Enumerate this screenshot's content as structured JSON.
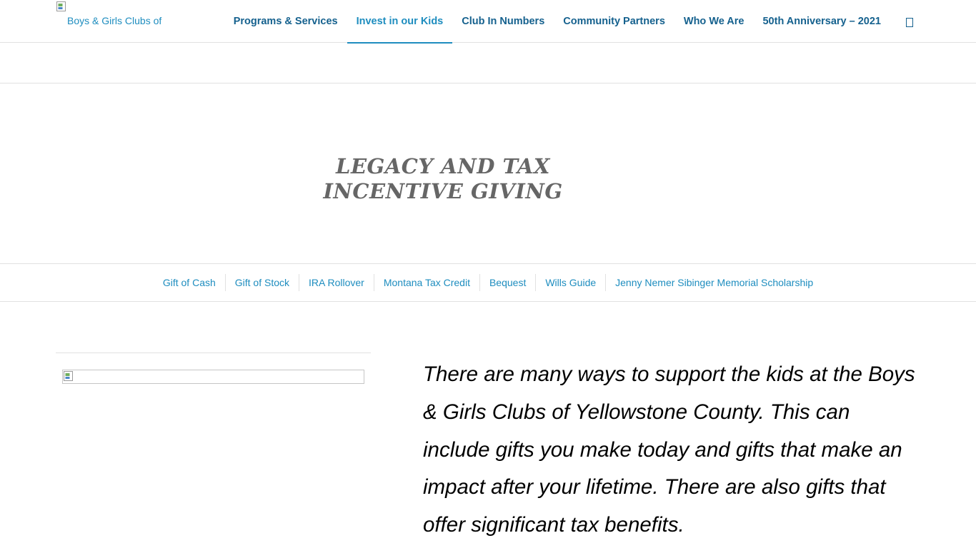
{
  "header": {
    "logo_alt": "Boys & Girls Clubs of",
    "nav": [
      {
        "label": "Programs & Services",
        "active": false
      },
      {
        "label": "Invest in our Kids",
        "active": true
      },
      {
        "label": "Club In Numbers",
        "active": false
      },
      {
        "label": "Community Partners",
        "active": false
      },
      {
        "label": "Who We Are",
        "active": false
      },
      {
        "label": "50th Anniversary – 2021",
        "active": false
      }
    ],
    "search_icon": "search-icon"
  },
  "hero": {
    "title_line1": "LEGACY AND TAX",
    "title_line2": "INCENTIVE GIVING"
  },
  "subnav": [
    "Gift of Cash",
    "Gift of Stock",
    "IRA Rollover",
    "Montana Tax Credit",
    "Bequest",
    "Wills Guide",
    "Jenny Nemer Sibinger Memorial Scholarship"
  ],
  "content": {
    "intro": "There are many ways to support the kids at the Boys & Girls Clubs of Yellowstone County. This can include gifts you make today and gifts that make an impact after your lifetime. There are also gifts that offer significant tax benefits."
  },
  "colors": {
    "nav_text": "#15618e",
    "accent": "#1e8dbf",
    "hero_title": "#666666",
    "border": "#e1e1e1"
  }
}
